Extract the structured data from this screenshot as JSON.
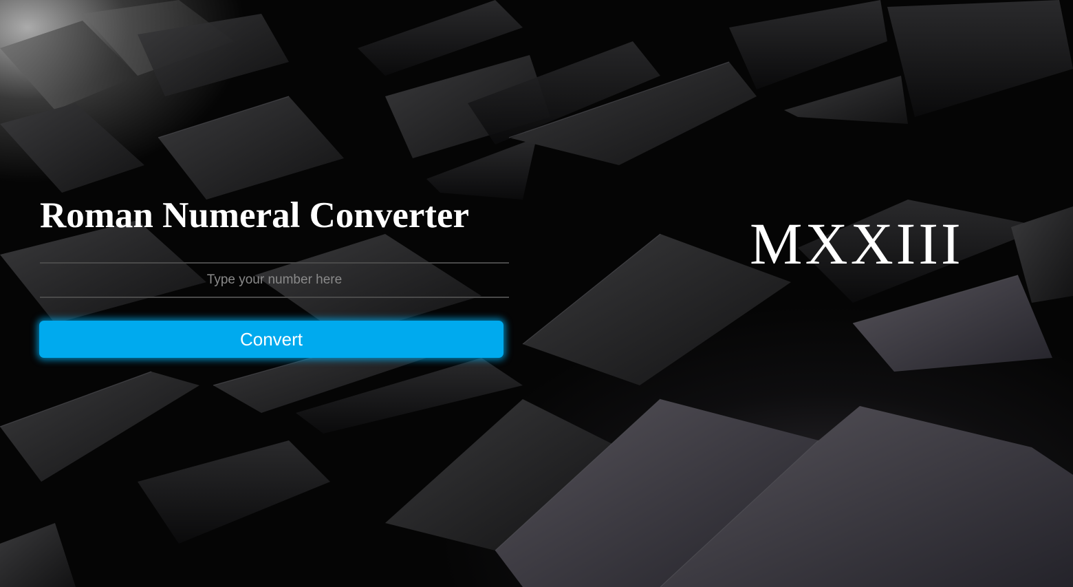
{
  "app": {
    "title": "Roman Numeral Converter"
  },
  "input": {
    "value": "",
    "placeholder": "Type your number here"
  },
  "button": {
    "convert_label": "Convert"
  },
  "result": {
    "roman": "MXXIII"
  },
  "colors": {
    "accent": "#00aaee",
    "background": "#050505",
    "text": "#ffffff"
  }
}
